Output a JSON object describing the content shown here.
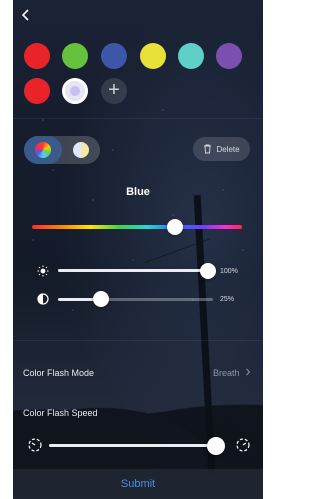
{
  "header": {
    "back_icon": "chevron-left-icon"
  },
  "palette": {
    "swatches": [
      {
        "color": "#e8232a"
      },
      {
        "color": "#66c23d"
      },
      {
        "color": "#3d56a8"
      },
      {
        "color": "#e8e238"
      },
      {
        "color": "#5fd0c8"
      },
      {
        "color": "#7b4fb0"
      },
      {
        "color": "#e8232a"
      },
      {
        "color": "#e7e4f6",
        "selected": true
      }
    ],
    "add_icon": "plus-icon",
    "add_label": "+"
  },
  "mode": {
    "active": "color-wheel",
    "options": [
      "color-wheel",
      "white-temperature"
    ]
  },
  "delete_button": {
    "label": "Delete",
    "icon": "trash-icon"
  },
  "color": {
    "name": "Blue",
    "hue_position": 0.68
  },
  "brightness": {
    "icon": "sun-icon",
    "value": "100%",
    "level": 1.0
  },
  "contrast": {
    "icon": "contrast-icon",
    "value": "25%",
    "level": 0.25
  },
  "settings": {
    "flash_mode": {
      "label": "Color Flash Mode",
      "value": "Breath",
      "chevron_icon": "chevron-right-icon"
    },
    "flash_speed": {
      "label": "Color Flash Speed",
      "level": 0.95,
      "slow_icon": "speed-slow-icon",
      "fast_icon": "speed-fast-icon"
    }
  },
  "submit": {
    "label": "Submit"
  }
}
